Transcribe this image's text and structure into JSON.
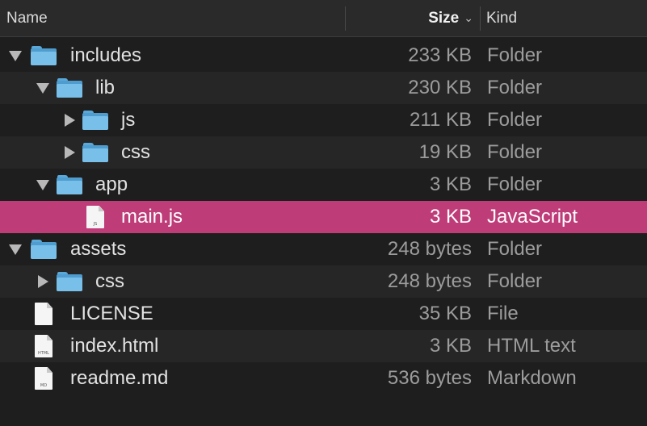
{
  "columns": {
    "name": "Name",
    "size": "Size",
    "kind": "Kind"
  },
  "sort_indicator": "chevron-down",
  "colors": {
    "selection": "#be3c77",
    "folder": "#78c0ea",
    "background": "#1e1e1e"
  },
  "rows": [
    {
      "name": "includes",
      "size": "233 KB",
      "kind": "Folder",
      "icon": "folder-icon",
      "disclosure": "expanded"
    },
    {
      "name": "lib",
      "size": "230 KB",
      "kind": "Folder",
      "icon": "folder-icon",
      "disclosure": "expanded"
    },
    {
      "name": "js",
      "size": "211 KB",
      "kind": "Folder",
      "icon": "folder-icon",
      "disclosure": "collapsed"
    },
    {
      "name": "css",
      "size": "19 KB",
      "kind": "Folder",
      "icon": "folder-icon",
      "disclosure": "collapsed"
    },
    {
      "name": "app",
      "size": "3 KB",
      "kind": "Folder",
      "icon": "folder-icon",
      "disclosure": "expanded"
    },
    {
      "name": "main.js",
      "size": "3 KB",
      "kind": "JavaScript",
      "icon": "js-file-icon",
      "icon_label": "JS",
      "selected": true
    },
    {
      "name": "assets",
      "size": "248 bytes",
      "kind": "Folder",
      "icon": "folder-icon",
      "disclosure": "expanded"
    },
    {
      "name": "css",
      "size": "248 bytes",
      "kind": "Folder",
      "icon": "folder-icon",
      "disclosure": "collapsed"
    },
    {
      "name": "LICENSE",
      "size": "35 KB",
      "kind": "File",
      "icon": "file-icon"
    },
    {
      "name": "index.html",
      "size": "3 KB",
      "kind": "HTML text",
      "icon": "html-file-icon",
      "icon_label": "HTML"
    },
    {
      "name": "readme.md",
      "size": "536 bytes",
      "kind": "Markdown",
      "icon": "md-file-icon",
      "icon_label": "MD"
    }
  ]
}
